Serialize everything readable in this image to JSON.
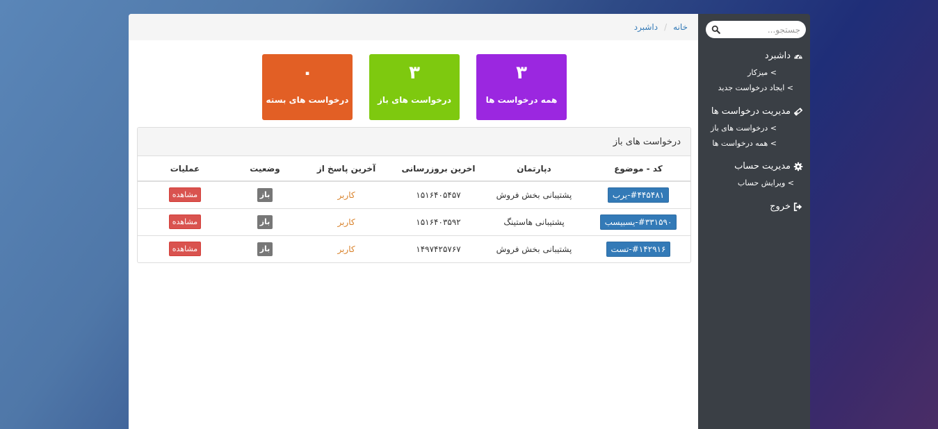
{
  "sidebar": {
    "search_placeholder": "جستجو...",
    "sections": [
      {
        "label": "داشبرد",
        "icon": "dashboard-icon",
        "items": [
          "> میزکار",
          "> ایجاد درخواست جدید"
        ]
      },
      {
        "label": "مدیریت درخواست ها",
        "icon": "ticket-icon",
        "items": [
          "> درخواست های باز",
          "> همه درخواست ها"
        ]
      },
      {
        "label": "مدیریت حساب",
        "icon": "gear-icon",
        "items": [
          "> ویرایش حساب"
        ]
      },
      {
        "label": "خروج",
        "icon": "sign-out-icon",
        "items": []
      }
    ]
  },
  "breadcrumb": {
    "home": "خانه",
    "separator": "/",
    "current": "داشبرد"
  },
  "stats": {
    "all": {
      "value": "۳",
      "label": "همه درخواست ها",
      "color": "#9b27e0"
    },
    "open": {
      "value": "۳",
      "label": "درخواست های باز",
      "color": "#7ec90f"
    },
    "closed": {
      "value": "۰",
      "label": "درخواست های بسته",
      "color": "#e25f25"
    }
  },
  "panel": {
    "title": "درخواست های باز",
    "columns": [
      "کد - موضوع",
      "دپارتمان",
      "اخرین بروزرسانی",
      "آخرین پاسخ از",
      "وضعیت",
      "عملیات"
    ],
    "rows": [
      {
        "code": "#۴۴۵۴۸۱-یرب",
        "department": "پشتیبانی بخش فروش",
        "updated": "۱۵۱۶۴۰۵۴۵۷",
        "last_reply": "کاربر",
        "status": "باز",
        "action": "مشاهده"
      },
      {
        "code": "#۳۳۱۵۹۰-یسبیسب",
        "department": "پشتیبانی هاستینگ",
        "updated": "۱۵۱۶۴۰۳۵۹۲",
        "last_reply": "کاربر",
        "status": "باز",
        "action": "مشاهده"
      },
      {
        "code": "#۱۴۲۹۱۶-تست",
        "department": "پشتیبانی بخش فروش",
        "updated": "۱۴۹۷۴۲۵۷۶۷",
        "last_reply": "کاربر",
        "status": "باز",
        "action": "مشاهده"
      }
    ]
  }
}
